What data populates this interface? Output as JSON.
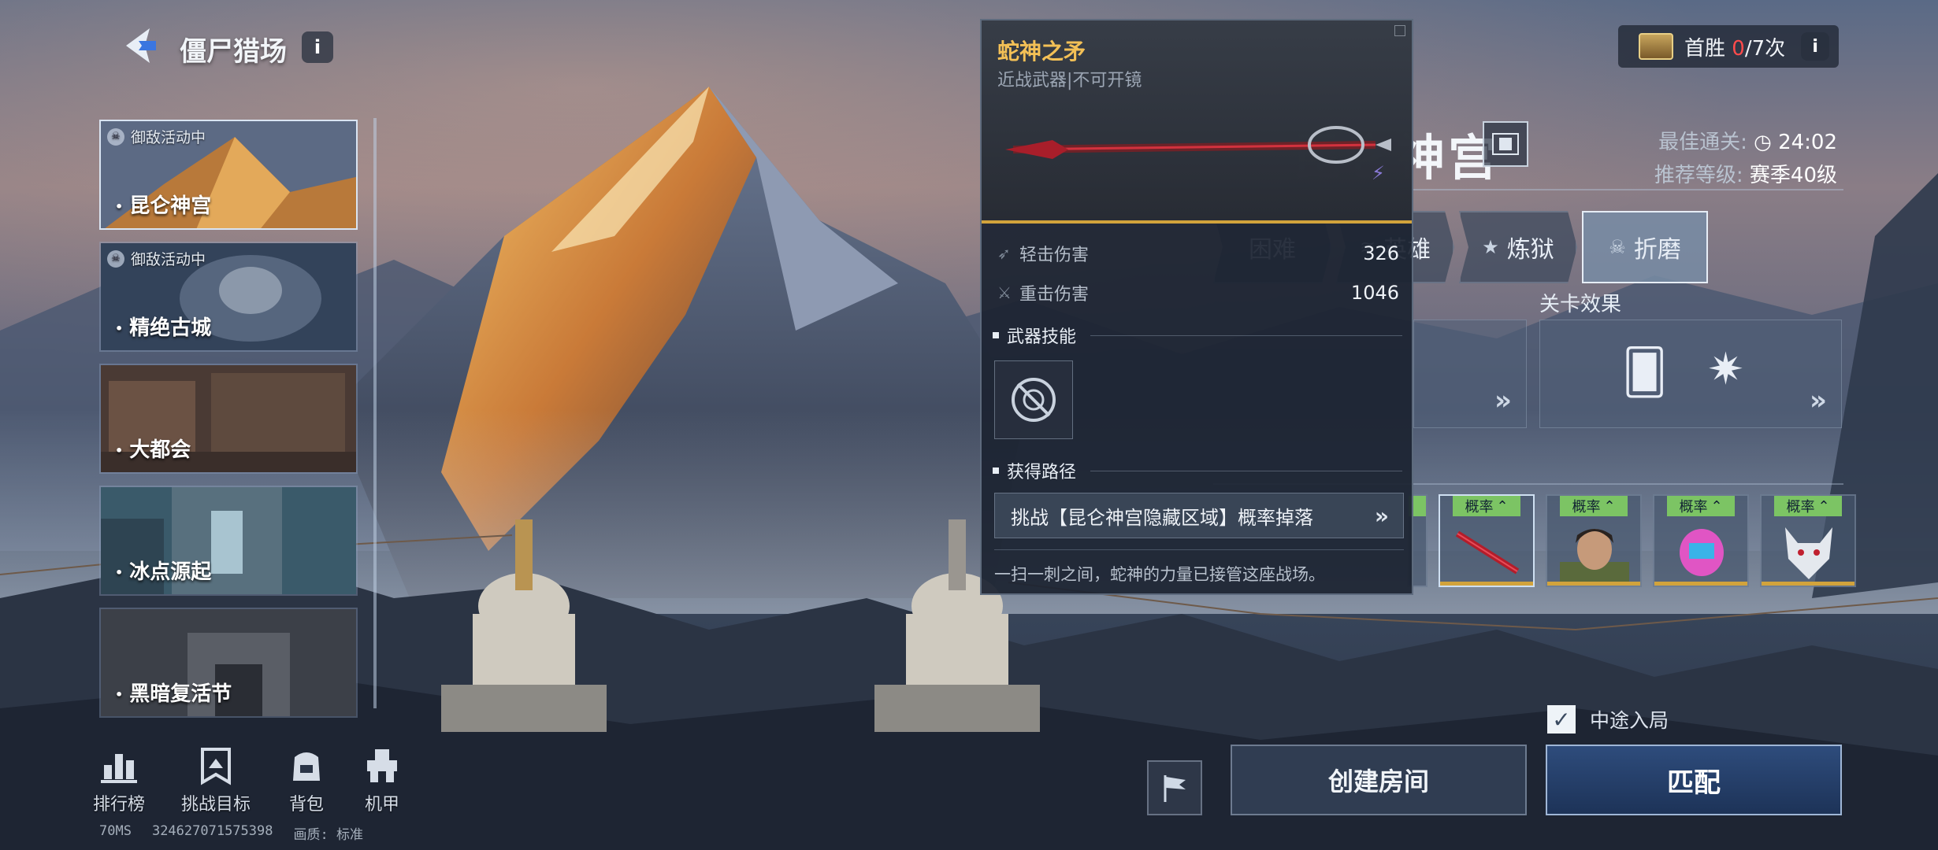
{
  "header": {
    "title": "僵尸猎场"
  },
  "maps": [
    {
      "name": "昆仑神宫",
      "event": "御敌活动中",
      "active": true
    },
    {
      "name": "精绝古城",
      "event": "御敌活动中",
      "active": false
    },
    {
      "name": "大都会",
      "event": "",
      "active": false
    },
    {
      "name": "冰点源起",
      "event": "",
      "active": false
    },
    {
      "name": "黑暗复活节",
      "event": "",
      "active": false
    }
  ],
  "bottom_nav": [
    {
      "label": "排行榜",
      "icon": "leaderboard-icon"
    },
    {
      "label": "挑战目标",
      "icon": "challenge-target-icon"
    },
    {
      "label": "背包",
      "icon": "backpack-icon"
    },
    {
      "label": "机甲",
      "icon": "mech-icon"
    }
  ],
  "status": {
    "ping": "70MS",
    "id": "324627071575398",
    "quality_label": "画质:",
    "quality": "标准"
  },
  "first_win": {
    "label": "首胜 ",
    "current": "0",
    "total": "/7次"
  },
  "map_detail": {
    "name": "昆仑神宫",
    "best_clear_label": "最佳通关:",
    "best_clear": "24:02",
    "recommend_label": "推荐等级:",
    "recommend": "赛季40级"
  },
  "difficulty_tabs": [
    {
      "label": "困难",
      "icon": "hard-icon"
    },
    {
      "label": "英雄",
      "icon": "hero-chevrons-icon"
    },
    {
      "label": "炼狱",
      "icon": "purgatory-star-icon"
    },
    {
      "label": "折磨",
      "icon": "skull-icon",
      "active": true
    }
  ],
  "stage_effects": {
    "label": "关卡效果"
  },
  "rewards": {
    "tag": "概率",
    "items": [
      {
        "icon": "snake-spear-icon",
        "selected": true
      },
      {
        "icon": "character-portrait-icon"
      },
      {
        "icon": "pink-mech-icon"
      },
      {
        "icon": "white-wolf-icon"
      }
    ]
  },
  "weapon_popup": {
    "name": "蛇神之矛",
    "type": "近战武器|不可开镜",
    "light_label": "轻击伤害",
    "light_value": "326",
    "heavy_label": "重击伤害",
    "heavy_value": "1046",
    "skill_title": "武器技能",
    "source_title": "获得路径",
    "source_text": "挑战【昆仑神宫隐藏区域】概率掉落",
    "flavor": "一扫一刺之间，蛇神的力量已接管这座战场。"
  },
  "actions": {
    "mid_join": "中途入局",
    "mid_join_checked": true,
    "create_room": "创建房间",
    "match": "匹配"
  },
  "colors": {
    "weapon_name": "#f3c056",
    "probability_tag": "#7cc464",
    "first_win_count": "#ff4b4b",
    "rarity_bar": "#d2a33c"
  }
}
